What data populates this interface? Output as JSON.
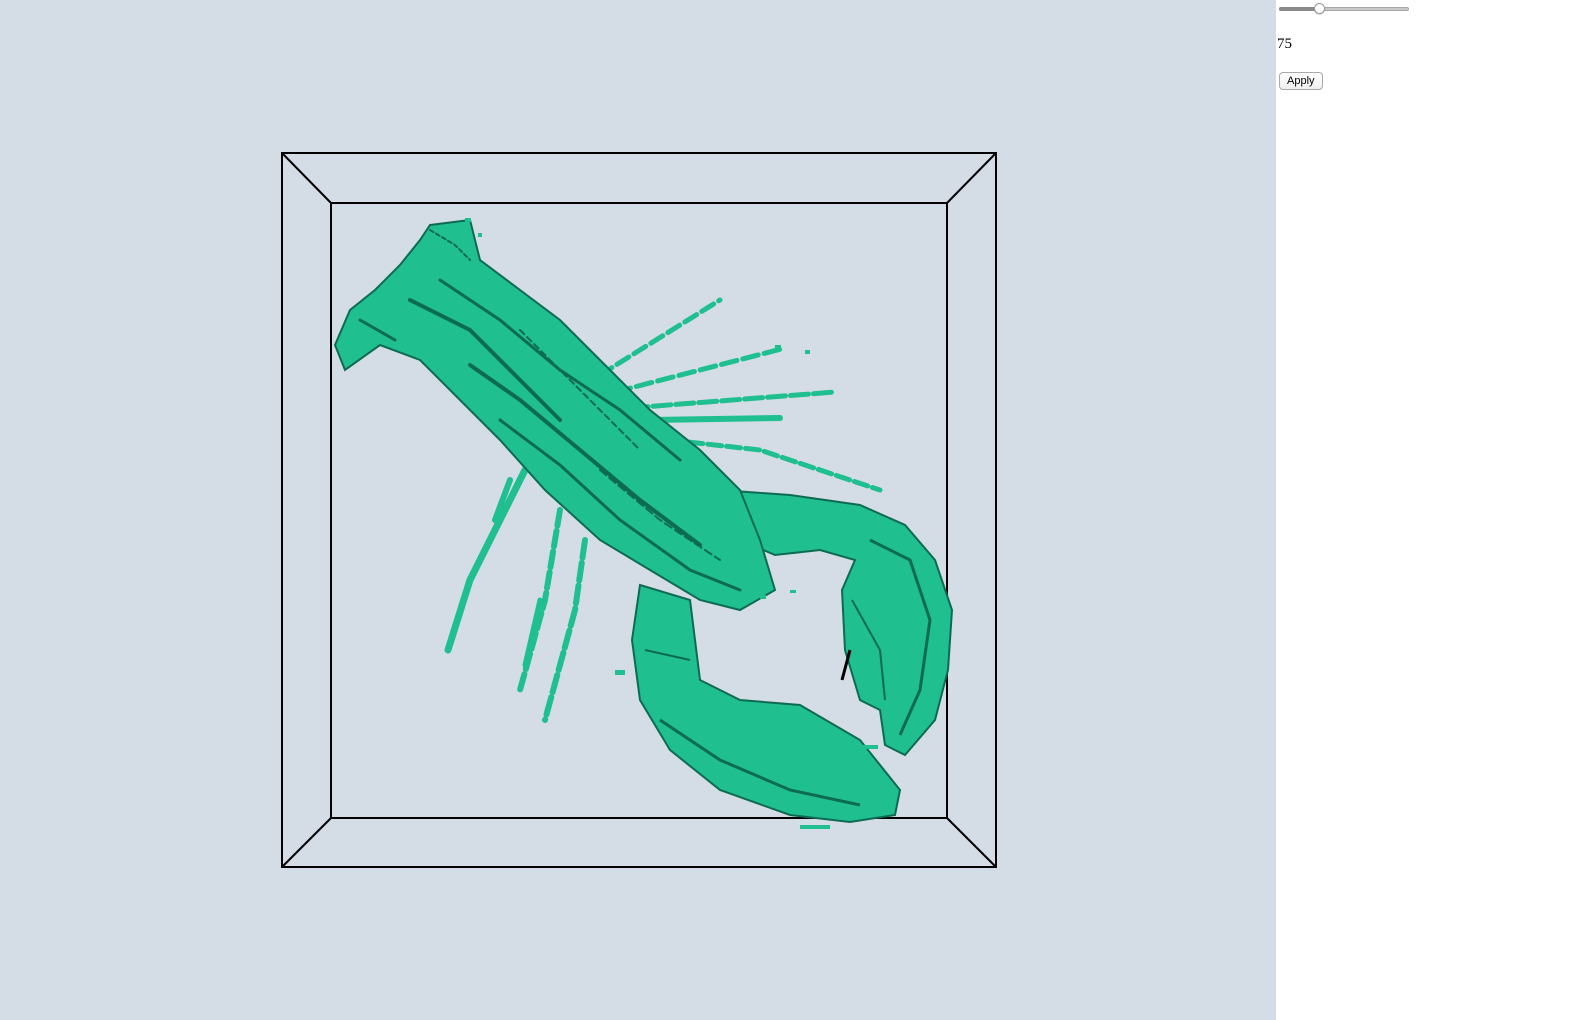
{
  "viewer": {
    "background_color": "#d4dce6",
    "mesh_color": "#1fbf8f",
    "mesh_shadow_color": "#0d6b52",
    "frame_color": "#000000",
    "object": "lobster-icon"
  },
  "controls": {
    "slider": {
      "value": 75,
      "min": 0,
      "max": 255
    },
    "value_text": "75",
    "apply_label": "Apply"
  }
}
